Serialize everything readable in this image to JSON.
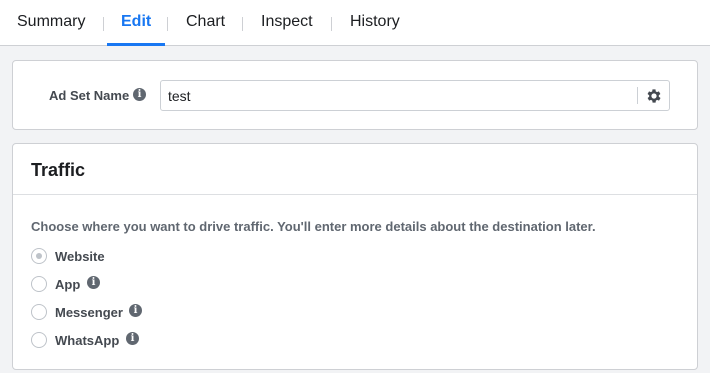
{
  "tabs": [
    {
      "label": "Summary",
      "active": false
    },
    {
      "label": "Edit",
      "active": true
    },
    {
      "label": "Chart",
      "active": false
    },
    {
      "label": "Inspect",
      "active": false
    },
    {
      "label": "History",
      "active": false
    }
  ],
  "ad_set": {
    "label": "Ad Set Name",
    "value": "test",
    "info_icon": "info-icon",
    "settings_icon": "gear-icon"
  },
  "traffic": {
    "title": "Traffic",
    "description": "Choose where you want to drive traffic. You'll enter more details about the destination later.",
    "options": [
      {
        "label": "Website",
        "selected": true,
        "info": false
      },
      {
        "label": "App",
        "selected": false,
        "info": true
      },
      {
        "label": "Messenger",
        "selected": false,
        "info": true
      },
      {
        "label": "WhatsApp",
        "selected": false,
        "info": true
      }
    ]
  },
  "colors": {
    "accent": "#1877f2",
    "text": "#1c1e21",
    "muted": "#606770",
    "border": "#ced0d4",
    "background": "#f2f3f5"
  }
}
